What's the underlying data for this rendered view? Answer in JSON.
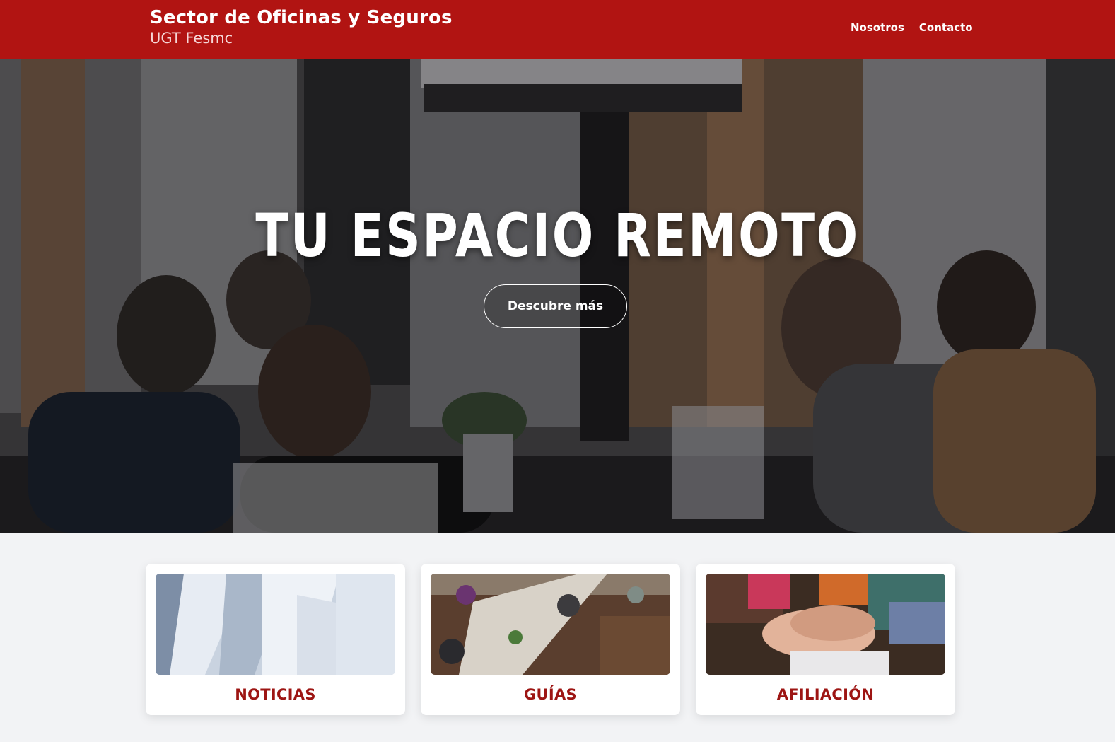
{
  "header": {
    "title": "Sector de Oficinas y Seguros",
    "subtitle": "UGT Fesmc",
    "nav": [
      {
        "label": "Nosotros"
      },
      {
        "label": "Contacto"
      }
    ],
    "bg_color": "#b11412"
  },
  "hero": {
    "title": "TU ESPACIO REMOTO",
    "button_label": "Descubre más"
  },
  "cards": [
    {
      "label": "NOTICIAS",
      "image": "newspapers-photo"
    },
    {
      "label": "GUÍAS",
      "image": "coworking-table-photo"
    },
    {
      "label": "AFILIACIÓN",
      "image": "stacked-hands-photo"
    }
  ],
  "colors": {
    "accent": "#b11412",
    "card_label": "#9d1513",
    "page_bg": "#f2f3f5"
  }
}
